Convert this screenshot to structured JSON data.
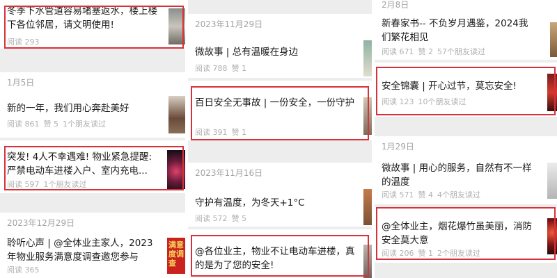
{
  "col1": {
    "a1": {
      "title": "冬季下水管道容易堵塞返水，楼上楼下各位邻居，请文明使用!",
      "read": "阅读 293"
    },
    "date1": "1月5日",
    "a2": {
      "title": "新的一年，我们用心奔赴美好",
      "read": "阅读 861",
      "like": "赞 5",
      "friends": "1个朋友读过"
    },
    "a3": {
      "title": "突发! 4人不幸遇难! 物业紧急提醒: 严禁电动车进楼入户、室内充电...",
      "read": "阅读 597",
      "friends": "1个朋友读过"
    },
    "date2": "2023年12月29日",
    "a4": {
      "title": "聆听心声 | @全体业主家人，2023年物业服务满意度调查邀您参与",
      "read": "阅读 365",
      "thumb_text": "满意度调查"
    }
  },
  "col2": {
    "date1": "2023年11月29日",
    "a1": {
      "title": "微故事 | 总有温暖在身边",
      "read": "阅读 788",
      "like": "赞 1"
    },
    "a2": {
      "title": "百日安全无事故 | 一份安全，一份守护",
      "read": "阅读 391",
      "like": "赞 1"
    },
    "date2": "2023年11月16日",
    "a3": {
      "title": "守护有温度，为冬天+1°C",
      "read": "阅读 572",
      "like": "赞 5"
    },
    "a4": {
      "title": "@各位业主，物业不让电动车进楼，真的是为了您的安全!"
    }
  },
  "col3": {
    "date1": "2月8日",
    "a1": {
      "title": "新春家书-- 不负岁月遇鉴，2024我们繁花相见",
      "read": "阅读 671",
      "like": "赞 2",
      "friends": "57个朋友读过"
    },
    "a2": {
      "title": "安全锦囊 | 开心过节，莫忘安全!",
      "read": "阅读 123",
      "friends": "10个朋友读过"
    },
    "date2": "1月29日",
    "a3": {
      "title": "微故事 | 用心的服务，自然有不一样的温度",
      "read": "阅读 571",
      "like": "赞 4",
      "friends": "4个朋友读过"
    },
    "a4": {
      "title": "@全体业主，烟花爆竹虽美丽，消防安全莫大意",
      "read": "阅读 206",
      "like": "赞 1",
      "friends": "2个朋友读过"
    }
  },
  "colors": {
    "highlight": "#d8313a",
    "meta_text": "#b0b0b0",
    "date_text": "#a3a3a3",
    "separator": "#ededed"
  }
}
